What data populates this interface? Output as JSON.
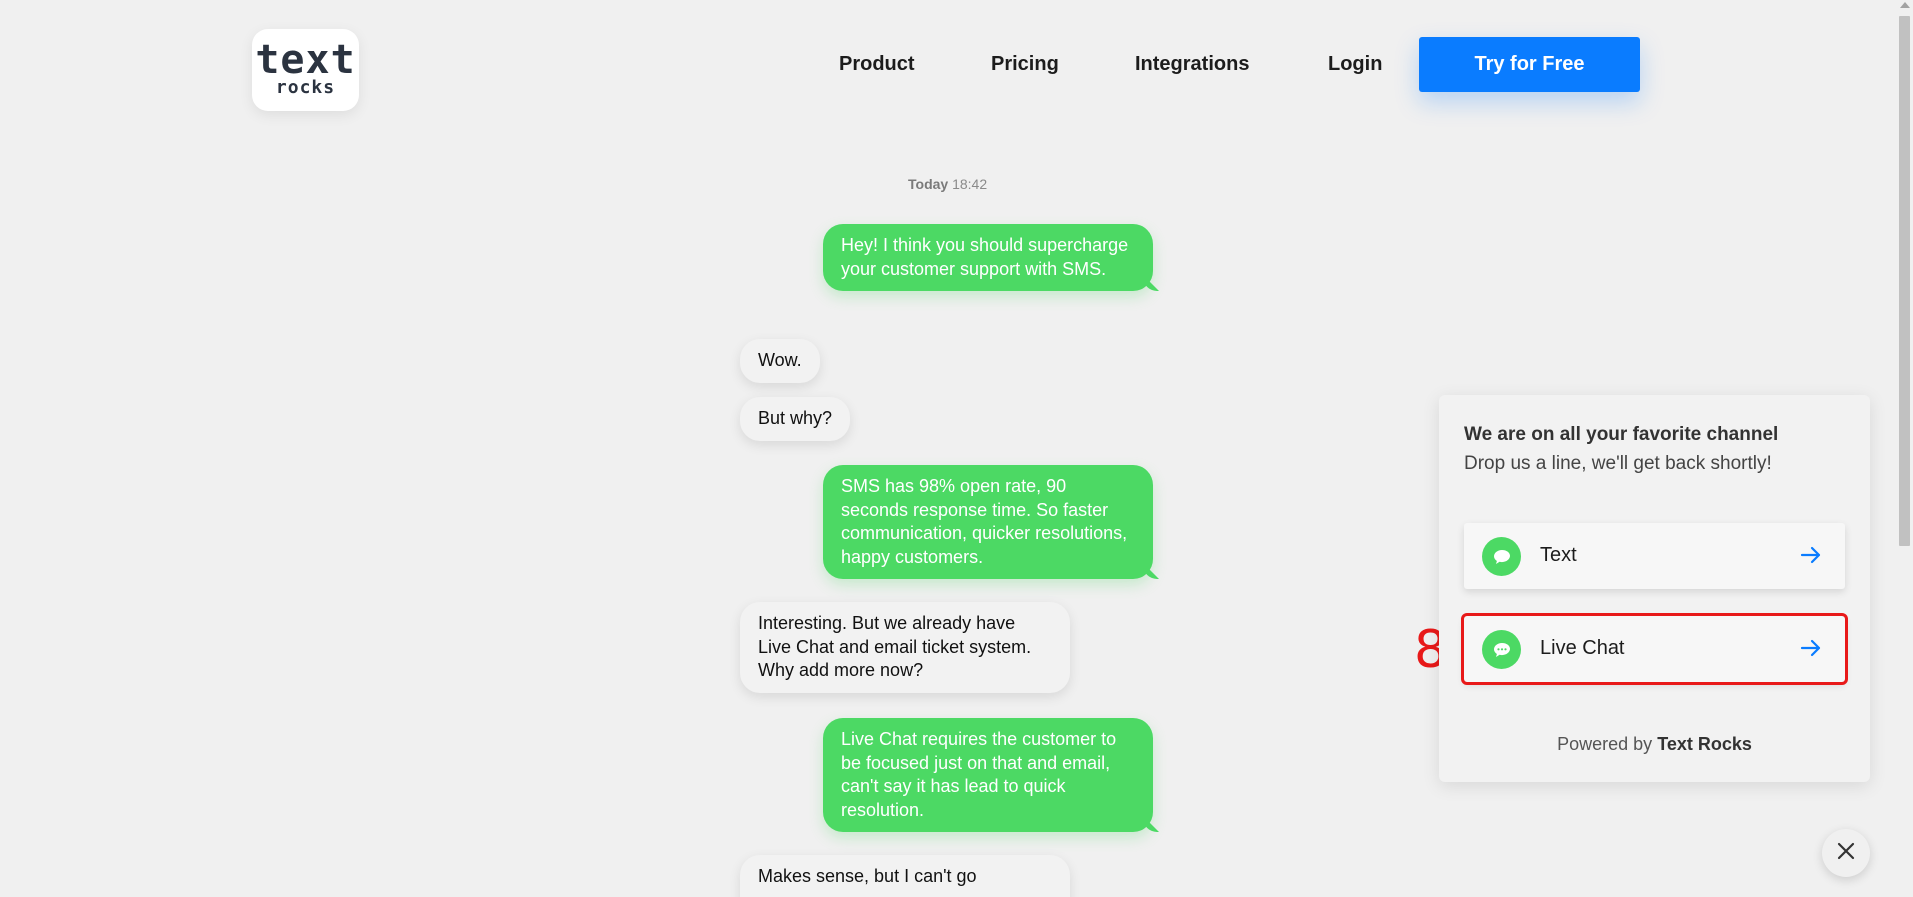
{
  "header": {
    "logo_line1": "text",
    "logo_line2": "rocks",
    "nav": [
      "Product",
      "Pricing",
      "Integrations",
      "Login"
    ],
    "cta_label": "Try for Free"
  },
  "chat": {
    "timestamp_day": "Today",
    "timestamp_time": "18:42",
    "messages": [
      {
        "from": "out",
        "text": "Hey! I think you should supercharge your customer support with SMS."
      },
      {
        "from": "in",
        "text": "Wow."
      },
      {
        "from": "in",
        "text": "But why?"
      },
      {
        "from": "out",
        "text": "SMS has 98% open rate, 90 seconds response time. So faster communication, quicker resolutions, happy customers."
      },
      {
        "from": "in",
        "text": "Interesting. But we already have Live Chat and email ticket system. Why add more now?"
      },
      {
        "from": "out",
        "text": "Live Chat requires the customer to be focused just on that and email, can't say it has lead to quick resolution."
      },
      {
        "from": "in",
        "text": "Makes sense, but I can't go"
      }
    ]
  },
  "widget": {
    "title": "We are on all your favorite channel",
    "subtitle": "Drop us a line, we'll get back shortly!",
    "channels": [
      {
        "label": "Text",
        "icon": "chat-bubble-icon"
      },
      {
        "label": "Live Chat",
        "icon": "chat-dots-icon"
      }
    ],
    "marker": "8",
    "powered_prefix": "Powered by",
    "powered_brand": "Text Rocks"
  },
  "colors": {
    "accent_blue": "#0a7cff",
    "bubble_green": "#4cd964",
    "highlight_red": "#e81919"
  }
}
